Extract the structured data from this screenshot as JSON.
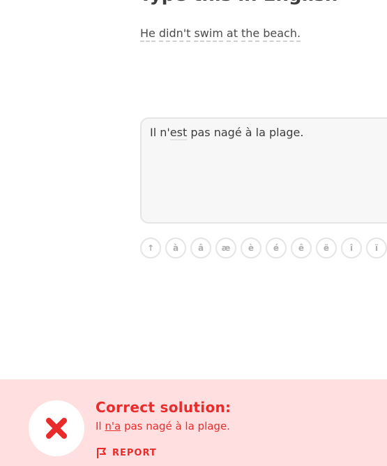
{
  "header": {
    "title_clipped": "Type this in English"
  },
  "prompt": {
    "words": [
      "He",
      "didn't",
      "swim",
      "at",
      "the",
      "beach."
    ]
  },
  "answer": {
    "prefix": "Il n'",
    "typo": "est",
    "suffix": " pas nagé à la plage."
  },
  "accent_keys": [
    "↑",
    "à",
    "â",
    "æ",
    "è",
    "é",
    "ê",
    "ë",
    "î",
    "ï"
  ],
  "feedback": {
    "title": "Correct solution:",
    "solution_prefix": "Il ",
    "solution_fix": "n'a",
    "solution_suffix": " pas nagé à la plage.",
    "report_label": "REPORT",
    "icon": "x-icon",
    "accent_color": "#ea2b2b",
    "background_color": "#ffdfe0"
  }
}
